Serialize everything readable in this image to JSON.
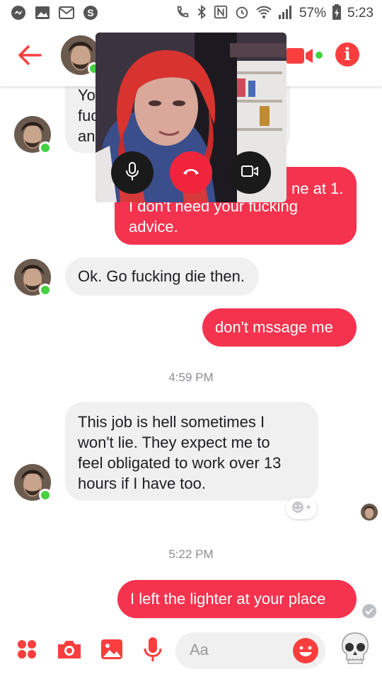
{
  "status_bar": {
    "battery": "57%",
    "time": "5:23"
  },
  "header": {
    "info_label": "i"
  },
  "messages": [
    {
      "id": "m1",
      "from": "them",
      "lines": [
        "Yo",
        "fuc",
        "an"
      ]
    },
    {
      "id": "m2",
      "from": "me",
      "lines": [
        "ne at 1.",
        "I don't need your fucking",
        "advice."
      ]
    },
    {
      "id": "m3",
      "from": "them",
      "lines": [
        "Ok. Go fucking die then."
      ]
    },
    {
      "id": "m4",
      "from": "me",
      "lines": [
        "don't mssage me"
      ]
    },
    {
      "id": "ts1",
      "type": "timestamp",
      "text": "4:59 PM"
    },
    {
      "id": "m5",
      "from": "them",
      "lines": [
        "This job is hell sometimes I",
        "won't lie. They expect me to",
        "feel obligated to work over 13",
        "hours if I have too."
      ]
    },
    {
      "id": "ts2",
      "type": "timestamp",
      "text": "5:22 PM"
    },
    {
      "id": "m6",
      "from": "me",
      "lines": [
        "I left the lighter at your place"
      ]
    }
  ],
  "composer": {
    "placeholder": "Aa"
  },
  "colors": {
    "accent": "#fa3e3e",
    "outgoing_bubble": "#f5334e",
    "incoming_bubble": "#f1f0f0",
    "online": "#44d13f"
  },
  "icons": {
    "status_left": [
      "messenger-icon",
      "gallery-icon",
      "gmail-icon",
      "skype-icon"
    ],
    "status_right": [
      "wifi-call-icon",
      "bluetooth-icon",
      "nfc-icon",
      "alarm-icon",
      "wifi-icon",
      "signal-icon",
      "battery-icon"
    ],
    "header": [
      "back-arrow-icon",
      "video-call-icon",
      "info-icon"
    ],
    "video_call": [
      "microphone-icon",
      "end-call-icon",
      "camera-toggle-icon"
    ],
    "composer": [
      "apps-grid-icon",
      "camera-icon",
      "image-icon",
      "microphone-icon",
      "emoji-icon",
      "skull-emoji"
    ]
  }
}
